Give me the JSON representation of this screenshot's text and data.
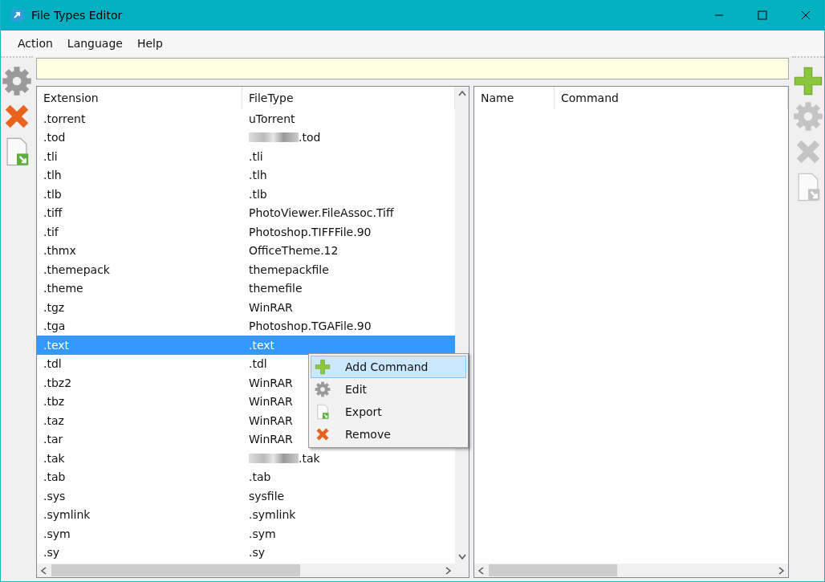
{
  "window": {
    "title": "File Types Editor"
  },
  "menu": [
    "Action",
    "Language",
    "Help"
  ],
  "left_toolbar": [
    {
      "kind": "gear",
      "disabled": false
    },
    {
      "kind": "remove",
      "disabled": false
    },
    {
      "kind": "export",
      "disabled": false
    }
  ],
  "file_types": {
    "columns": [
      "Extension",
      "FileType"
    ],
    "rows": [
      {
        "extension": ".torrent",
        "filetype": "uTorrent",
        "selected": false,
        "redacted": false
      },
      {
        "extension": ".tod",
        "filetype": ".tod",
        "selected": false,
        "redacted": true
      },
      {
        "extension": ".tli",
        "filetype": ".tli",
        "selected": false,
        "redacted": false
      },
      {
        "extension": ".tlh",
        "filetype": ".tlh",
        "selected": false,
        "redacted": false
      },
      {
        "extension": ".tlb",
        "filetype": ".tlb",
        "selected": false,
        "redacted": false
      },
      {
        "extension": ".tiff",
        "filetype": "PhotoViewer.FileAssoc.Tiff",
        "selected": false,
        "redacted": false
      },
      {
        "extension": ".tif",
        "filetype": "Photoshop.TIFFFile.90",
        "selected": false,
        "redacted": false
      },
      {
        "extension": ".thmx",
        "filetype": "OfficeTheme.12",
        "selected": false,
        "redacted": false
      },
      {
        "extension": ".themepack",
        "filetype": "themepackfile",
        "selected": false,
        "redacted": false
      },
      {
        "extension": ".theme",
        "filetype": "themefile",
        "selected": false,
        "redacted": false
      },
      {
        "extension": ".tgz",
        "filetype": "WinRAR",
        "selected": false,
        "redacted": false
      },
      {
        "extension": ".tga",
        "filetype": "Photoshop.TGAFile.90",
        "selected": false,
        "redacted": false
      },
      {
        "extension": ".text",
        "filetype": ".text",
        "selected": true,
        "redacted": false
      },
      {
        "extension": ".tdl",
        "filetype": ".tdl",
        "selected": false,
        "redacted": false
      },
      {
        "extension": ".tbz2",
        "filetype": "WinRAR",
        "selected": false,
        "redacted": false
      },
      {
        "extension": ".tbz",
        "filetype": "WinRAR",
        "selected": false,
        "redacted": false
      },
      {
        "extension": ".taz",
        "filetype": "WinRAR",
        "selected": false,
        "redacted": false
      },
      {
        "extension": ".tar",
        "filetype": "WinRAR",
        "selected": false,
        "redacted": false
      },
      {
        "extension": ".tak",
        "filetype": ".tak",
        "selected": false,
        "redacted": true
      },
      {
        "extension": ".tab",
        "filetype": ".tab",
        "selected": false,
        "redacted": false
      },
      {
        "extension": ".sys",
        "filetype": "sysfile",
        "selected": false,
        "redacted": false
      },
      {
        "extension": ".symlink",
        "filetype": ".symlink",
        "selected": false,
        "redacted": false
      },
      {
        "extension": ".sym",
        "filetype": ".sym",
        "selected": false,
        "redacted": false
      },
      {
        "extension": ".sy",
        "filetype": ".sy",
        "selected": false,
        "redacted": false
      }
    ]
  },
  "context_menu": [
    {
      "kind": "add",
      "label": "Add Command",
      "selected": true
    },
    {
      "kind": "gear",
      "label": "Edit",
      "selected": false
    },
    {
      "kind": "export",
      "label": "Export",
      "selected": false
    },
    {
      "kind": "remove",
      "label": "Remove",
      "selected": false
    }
  ],
  "commands": {
    "columns": [
      "Name",
      "Command"
    ]
  },
  "right_toolbar": [
    {
      "kind": "add",
      "disabled": false
    },
    {
      "kind": "gear",
      "disabled": true
    },
    {
      "kind": "remove",
      "disabled": true
    },
    {
      "kind": "export",
      "disabled": true
    }
  ]
}
